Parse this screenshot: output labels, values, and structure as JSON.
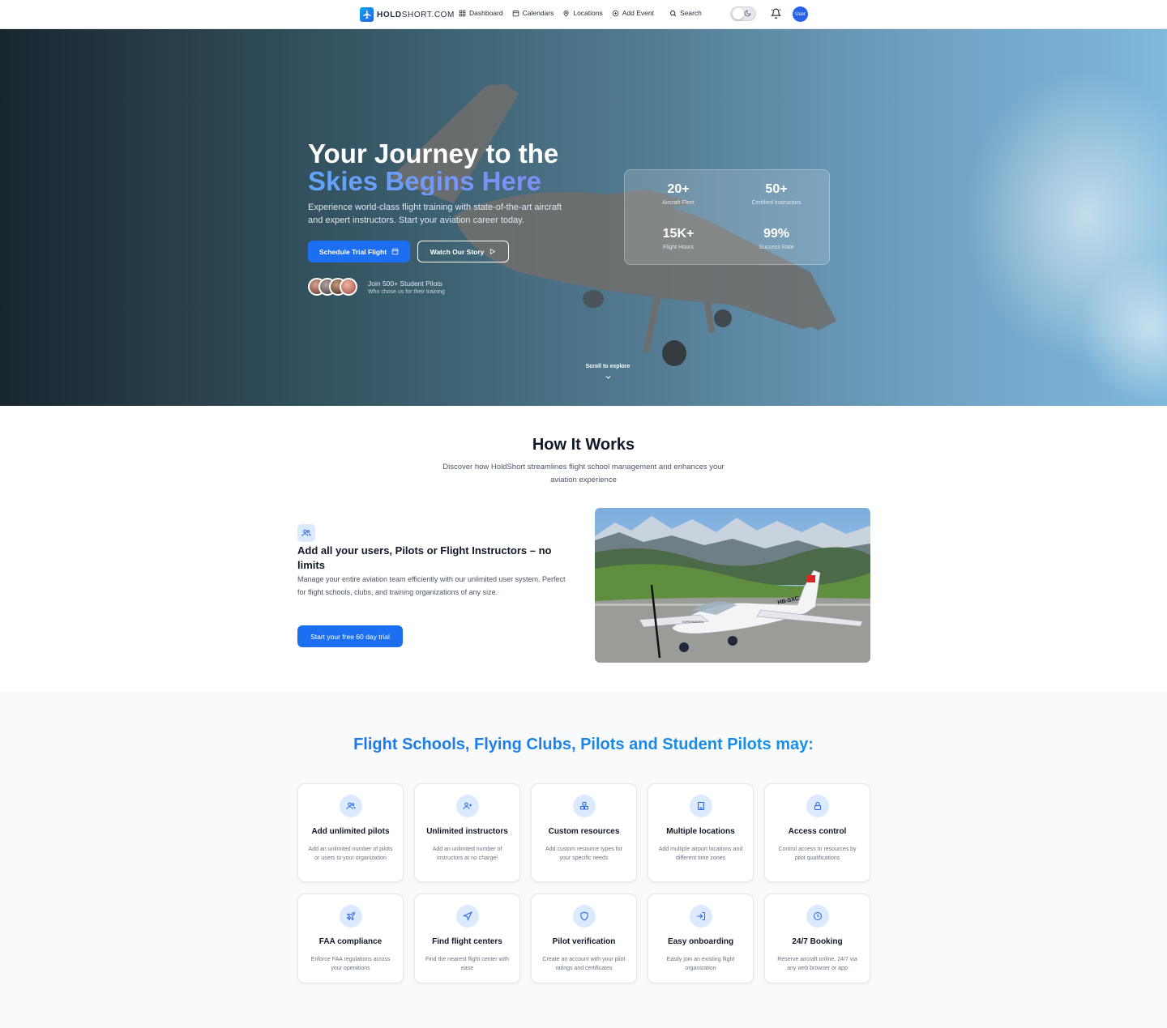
{
  "nav": {
    "brand_bold": "HOLD",
    "brand_rest": "SHORT.COM",
    "links": [
      {
        "label": "Dashboard",
        "icon": "grid-icon"
      },
      {
        "label": "Calendars",
        "icon": "calendar-icon"
      },
      {
        "label": "Locations",
        "icon": "map-pin-icon"
      },
      {
        "label": "Add Event",
        "icon": "plus-circle-icon"
      },
      {
        "label": "Search",
        "icon": "search-icon"
      }
    ],
    "avatar_label": "User"
  },
  "hero": {
    "title_line1": "Your Journey to the",
    "title_line2": "Skies Begins Here",
    "subtitle": "Experience world-class flight training with state-of-the-art aircraft and expert instructors. Start your aviation career today.",
    "cta_primary": "Schedule Trial Flight",
    "cta_secondary": "Watch Our Story",
    "students_title": "Join 500+ Student Pilots",
    "students_subtitle": "Who chose us for their training",
    "stats": [
      {
        "value": "20+",
        "label": "Aircraft Fleet"
      },
      {
        "value": "50+",
        "label": "Certified Instructors"
      },
      {
        "value": "15K+",
        "label": "Flight Hours"
      },
      {
        "value": "99%",
        "label": "Success Rate"
      }
    ],
    "scroll_hint": "Scroll to explore"
  },
  "how_it_works": {
    "title": "How It Works",
    "subtitle": "Discover how HoldShort streamlines flight school management and enhances your aviation experience",
    "feature_title": "Add all your users, Pilots or Flight Instructors – no limits",
    "feature_text": "Manage your entire aviation team efficiently with our unlimited user system. Perfect for flight schools, clubs, and training organizations of any size.",
    "feature_button": "Start your free 60 day trial",
    "image_registration": "HB-SXC",
    "image_marking": "EXPERIMENTAL"
  },
  "features": {
    "title": "Flight Schools, Flying Clubs, Pilots and Student Pilots may:",
    "cards": [
      {
        "icon": "users-icon",
        "title": "Add unlimited pilots",
        "text": "Add an unlimited number of pilots or users to your organization"
      },
      {
        "icon": "user-plus-icon",
        "title": "Unlimited instructors",
        "text": "Add an unlimited number of instructors at no charge!"
      },
      {
        "icon": "boxes-icon",
        "title": "Custom resources",
        "text": "Add custom resource types for your specific needs"
      },
      {
        "icon": "building-icon",
        "title": "Multiple locations",
        "text": "Add multiple airport locations and different time zones"
      },
      {
        "icon": "lock-icon",
        "title": "Access control",
        "text": "Control access to resources by pilot qualifications"
      },
      {
        "icon": "plane-icon",
        "title": "FAA compliance",
        "text": "Enforce FAA regulations across your operations"
      },
      {
        "icon": "navigation-icon",
        "title": "Find flight centers",
        "text": "Find the nearest flight center with ease"
      },
      {
        "icon": "shield-icon",
        "title": "Pilot verification",
        "text": "Create an account with your pilot ratings and certificates"
      },
      {
        "icon": "sign-in-icon",
        "title": "Easy onboarding",
        "text": "Easily join an existing flight organization"
      },
      {
        "icon": "clock-icon",
        "title": "24/7 Booking",
        "text": "Reserve aircraft online, 24/7 via any web browser or app"
      }
    ]
  },
  "colors": {
    "primary": "#1d6ff2",
    "icon_blue": "#2563eb",
    "icon_bg": "#dbeafe",
    "hero_dark": "#18262f",
    "hero_light": "#7fb9dc"
  }
}
